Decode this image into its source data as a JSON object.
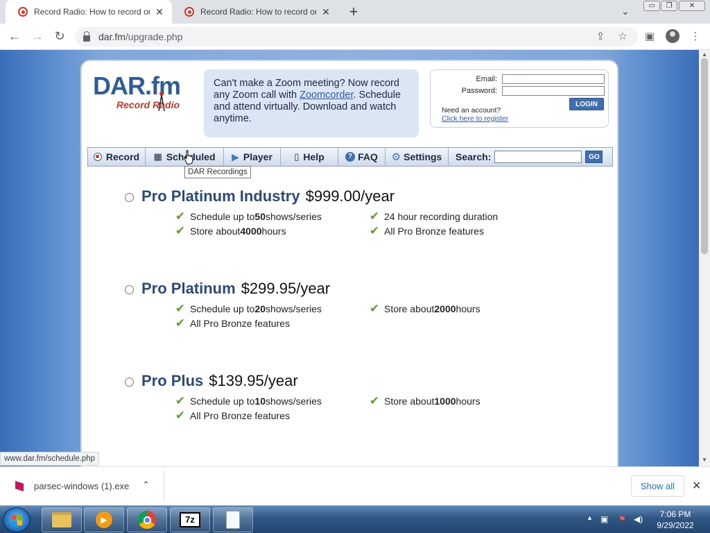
{
  "browser": {
    "tabs": [
      {
        "title": "Record Radio: How to record onl",
        "close": "✕"
      },
      {
        "title": "Record Radio: How to record onl",
        "close": "✕"
      }
    ],
    "new_tab": "+",
    "url_host": "dar.fm",
    "url_path": "/upgrade.php",
    "window_buttons": [
      "▭",
      "❐",
      "✕"
    ]
  },
  "logo": {
    "brand": "DAR.fm",
    "tagline": "Record Radio"
  },
  "promo": {
    "text_before": "Can't make a Zoom meeting? Now record any Zoom call with ",
    "link": "Zoomcorder",
    "text_after": ". Schedule and attend virtually. Download and watch anytime."
  },
  "login": {
    "email_label": "Email:",
    "password_label": "Password:",
    "button": "LOGIN",
    "need_account": "Need an account?",
    "register_link": "Click here to register"
  },
  "navbar": {
    "items": [
      {
        "label": "Record",
        "icon": "record-dot-icon"
      },
      {
        "label": "Scheduled",
        "icon": "calendar-icon"
      },
      {
        "label": "Player",
        "icon": "play-icon"
      },
      {
        "label": "Help",
        "icon": "phone-icon"
      },
      {
        "label": "FAQ",
        "icon": "question-icon"
      },
      {
        "label": "Settings",
        "icon": "gear-icon"
      }
    ],
    "search_label": "Search:",
    "go": "GO"
  },
  "tooltip": "DAR Recordings",
  "plans": [
    {
      "name": "Pro Platinum Industry",
      "price": "$999.00/year",
      "features": [
        {
          "pre": "Schedule up to ",
          "bold": "50",
          "post": " shows/series"
        },
        {
          "pre": "24 hour recording duration",
          "bold": "",
          "post": ""
        },
        {
          "pre": "Store about ",
          "bold": "4000",
          "post": " hours"
        },
        {
          "pre": "All Pro Bronze features",
          "bold": "",
          "post": ""
        }
      ]
    },
    {
      "name": "Pro Platinum",
      "price": "$299.95/year",
      "features": [
        {
          "pre": "Schedule up to ",
          "bold": "20",
          "post": " shows/series"
        },
        {
          "pre": "Store about ",
          "bold": "2000",
          "post": " hours"
        },
        {
          "pre": "All Pro Bronze features",
          "bold": "",
          "post": ""
        }
      ]
    },
    {
      "name": "Pro Plus",
      "price": "$139.95/year",
      "features": [
        {
          "pre": "Schedule up to ",
          "bold": "10",
          "post": " shows/series"
        },
        {
          "pre": "Store about ",
          "bold": "1000",
          "post": " hours"
        },
        {
          "pre": "All Pro Bronze features",
          "bold": "",
          "post": ""
        }
      ]
    }
  ],
  "status_url": "www.dar.fm/schedule.php",
  "downloads": {
    "file": "parsec-windows (1).exe",
    "show_all": "Show all",
    "close": "✕"
  },
  "taskbar": {
    "time": "7:06 PM",
    "date": "9/29/2022",
    "tray_arrow": "▲"
  },
  "colors": {
    "accent": "#2b4a78",
    "check": "#5aa02c",
    "logo_red": "#c0392b"
  }
}
